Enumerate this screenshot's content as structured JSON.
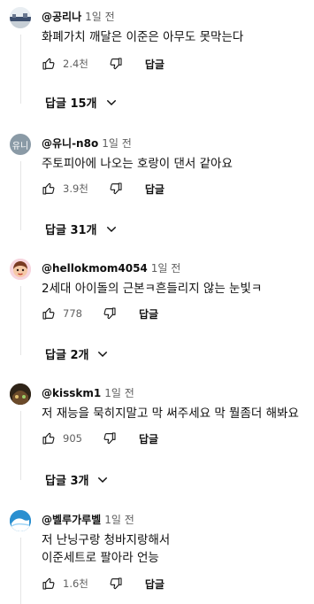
{
  "comments": [
    {
      "author": "@공리나",
      "time": "1일 전",
      "lines": [
        "화폐가치 깨달은 이준은 아무도 못막는다"
      ],
      "likes": "2.4천",
      "reply_label": "답글",
      "replies_label": "답글 15개",
      "avatar": {
        "type": "landscape"
      }
    },
    {
      "author": "@유니-n8o",
      "time": "1일 전",
      "lines": [
        "주토피아에 나오는 호랑이 댄서 같아요"
      ],
      "likes": "3.9천",
      "reply_label": "답글",
      "replies_label": "답글 31개",
      "avatar": {
        "type": "initials",
        "text": "유니",
        "color": "#8a9aa6"
      }
    },
    {
      "author": "@hellokmom4054",
      "time": "1일 전",
      "lines": [
        "2세대 아이돌의 근본ㅋ흔들리지 않는 눈빛ㅋ"
      ],
      "likes": "778",
      "reply_label": "답글",
      "replies_label": "답글 2개",
      "avatar": {
        "type": "face"
      }
    },
    {
      "author": "@kisskm1",
      "time": "1일 전",
      "lines": [
        "저 재능을 묵히지말고 막 써주세요 막 뭘좀더 해봐요"
      ],
      "likes": "905",
      "reply_label": "답글",
      "replies_label": "답글 3개",
      "avatar": {
        "type": "dark"
      }
    },
    {
      "author": "@벨루가루벨",
      "time": "1일 전",
      "lines": [
        "저 난닝구랑 청바지랑해서",
        "이준세트로 팔아라 언능"
      ],
      "likes": "1.6천",
      "reply_label": "답글",
      "replies_label": "",
      "avatar": {
        "type": "wave"
      }
    }
  ]
}
